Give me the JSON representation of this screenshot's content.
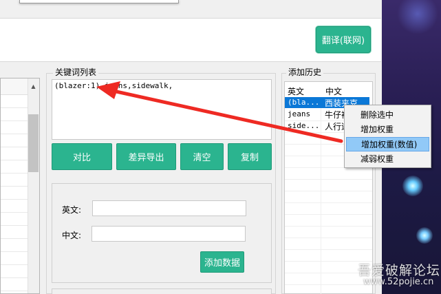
{
  "translate_button": "翻译(联网)",
  "keyword_group": {
    "title": "关键词列表",
    "text": "(blazer:1),jeans,sidewalk,",
    "buttons": [
      "对比",
      "差异导出",
      "清空",
      "复制"
    ],
    "english_label": "英文:",
    "chinese_label": "中文:",
    "english_value": "",
    "chinese_value": "",
    "add_button": "添加数据"
  },
  "history_group": {
    "title": "添加历史",
    "columns": [
      "英文",
      "中文"
    ],
    "rows": [
      {
        "en": "(bla...",
        "zh": "西装夹克",
        "selected": true
      },
      {
        "en": "jeans",
        "zh": "牛仔裤",
        "selected": false
      },
      {
        "en": "side...",
        "zh": "人行道",
        "selected": false
      }
    ]
  },
  "context_menu": {
    "items": [
      "删除选中",
      "增加权重",
      "增加权重(数值)",
      "减弱权重"
    ],
    "highlighted_index": 2
  },
  "watermark": {
    "name": "吾爱破解论坛",
    "url": "www.52pojie.cn"
  },
  "colors": {
    "accent_green": "#2bb48f",
    "selection_blue": "#0b78d7",
    "menu_highlight": "#91c9f7",
    "annotation_arrow": "#ee2a23"
  }
}
